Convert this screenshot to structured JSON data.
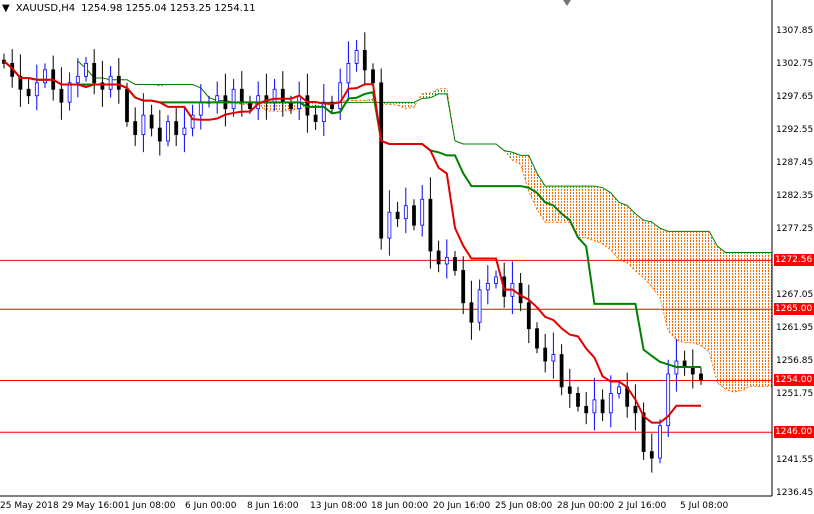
{
  "header": {
    "symbol": "XAUUSD,H4",
    "open": "1254.98",
    "high": "1255.04",
    "low": "1253.25",
    "close": "1254.11"
  },
  "price_axis": [
    "1307.85",
    "1302.75",
    "1297.65",
    "1292.55",
    "1287.45",
    "1282.35",
    "1277.25",
    "1267.05",
    "1261.95",
    "1256.85",
    "1251.75",
    "1241.55",
    "1236.45"
  ],
  "levels": [
    {
      "price": 1272.56,
      "label": "1272.56"
    },
    {
      "price": 1265.0,
      "label": "1265.00"
    },
    {
      "price": 1254.0,
      "label": "1254.00"
    },
    {
      "price": 1246.0,
      "label": "1246.00"
    }
  ],
  "time_axis": [
    "25 May 2018",
    "29 May 16:00",
    "1 Jun 08:00",
    "6 Jun 00:00",
    "8 Jun 16:00",
    "13 Jun 08:00",
    "18 Jun 00:00",
    "20 Jun 16:00",
    "25 Jun 08:00",
    "28 Jun 00:00",
    "2 Jul 16:00",
    "5 Jul 08:00"
  ],
  "colors": {
    "bull": "#0000ff",
    "bear": "#000000",
    "tenkan": "#e00000",
    "kijun": "#008000",
    "cloud": "#ff6a00",
    "level": "#ff0000"
  },
  "chart_data": {
    "type": "candlestick",
    "ylim": [
      1236.45,
      1307.85
    ],
    "closes": [
      1303,
      1301,
      1299,
      1298,
      1300,
      1302,
      1299,
      1297,
      1300,
      1301,
      1303,
      1300,
      1299,
      1301,
      1299,
      1294,
      1292,
      1295,
      1293,
      1291,
      1294,
      1292,
      1293,
      1295,
      1297,
      1297,
      1298,
      1296,
      1299,
      1297,
      1296,
      1298,
      1297,
      1299,
      1297,
      1296,
      1298,
      1295,
      1294,
      1297,
      1296,
      1300,
      1303,
      1305,
      1302,
      1300,
      1276,
      1280,
      1279,
      1281,
      1278,
      1282,
      1274,
      1272,
      1273,
      1271,
      1266,
      1263,
      1268,
      1269,
      1270,
      1267,
      1269,
      1266,
      1262,
      1259,
      1257,
      1258,
      1253,
      1252,
      1250,
      1249,
      1251,
      1249,
      1252,
      1253,
      1250,
      1249,
      1243,
      1242,
      1247,
      1255,
      1257,
      1256,
      1255,
      1254.11
    ]
  }
}
